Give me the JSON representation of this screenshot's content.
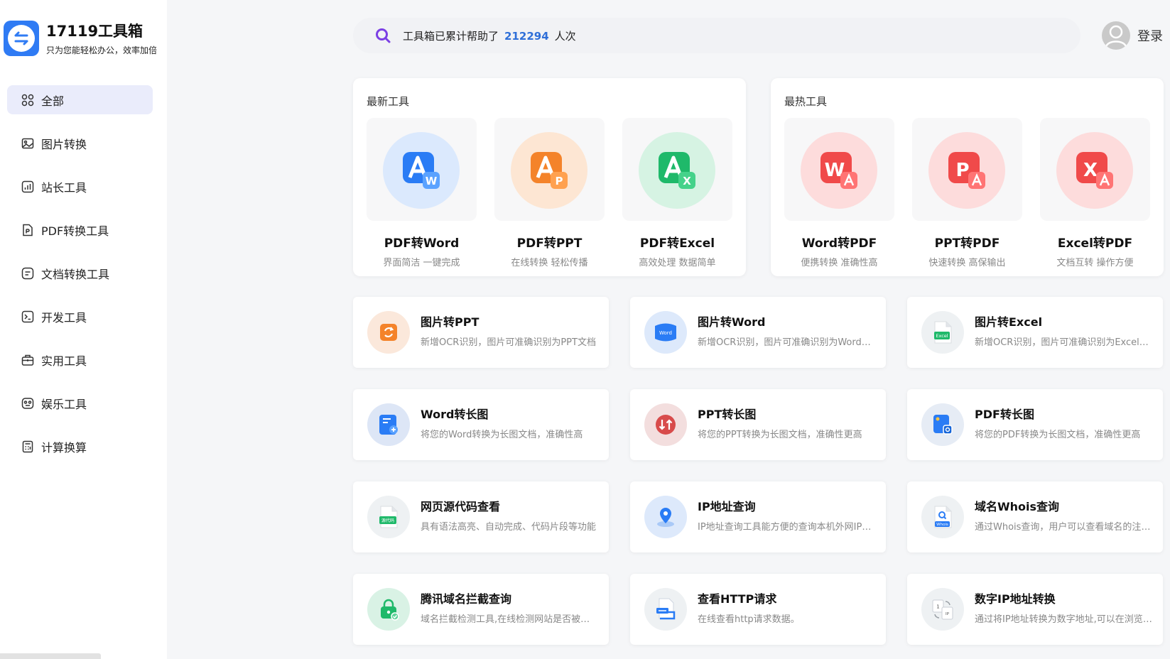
{
  "brand": {
    "name": "17119工具箱",
    "tagline": "只为您能轻松办公，效率加倍"
  },
  "sidebar": {
    "items": [
      {
        "label": "全部",
        "icon": "grid-icon",
        "active": true
      },
      {
        "label": "图片转换",
        "icon": "image-icon"
      },
      {
        "label": "站长工具",
        "icon": "chart-icon"
      },
      {
        "label": "PDF转换工具",
        "icon": "pdf-icon"
      },
      {
        "label": "文档转换工具",
        "icon": "document-icon"
      },
      {
        "label": "开发工具",
        "icon": "terminal-icon"
      },
      {
        "label": "实用工具",
        "icon": "toolbox-icon"
      },
      {
        "label": "娱乐工具",
        "icon": "game-icon"
      },
      {
        "label": "计算换算",
        "icon": "calculator-icon"
      }
    ]
  },
  "search": {
    "prefix": "工具箱已累计帮助了",
    "count": "212294",
    "suffix": "人次"
  },
  "user": {
    "login_label": "登录"
  },
  "featured": {
    "latest": {
      "title": "最新工具",
      "items": [
        {
          "name": "PDF转Word",
          "desc": "界面简洁 一键完成",
          "icon": "pdf-to-word-icon",
          "color": "#2a7cf5"
        },
        {
          "name": "PDF转PPT",
          "desc": "在线转换 轻松传播",
          "icon": "pdf-to-ppt-icon",
          "color": "#f4832a"
        },
        {
          "name": "PDF转Excel",
          "desc": "高效处理 数据简单",
          "icon": "pdf-to-excel-icon",
          "color": "#1fb96a"
        }
      ]
    },
    "hottest": {
      "title": "最热工具",
      "items": [
        {
          "name": "Word转PDF",
          "desc": "便携转换 准确性高",
          "icon": "word-to-pdf-icon",
          "color": "#f04a4a"
        },
        {
          "name": "PPT转PDF",
          "desc": "快速转换 高保输出",
          "icon": "ppt-to-pdf-icon",
          "color": "#f04a4a"
        },
        {
          "name": "Excel转PDF",
          "desc": "文档互转 操作方便",
          "icon": "excel-to-pdf-icon",
          "color": "#f04a4a"
        }
      ]
    }
  },
  "tools": [
    {
      "title": "图片转PPT",
      "desc": "新增OCR识别，图片可准确识别为PPT文档",
      "icon": "image-to-ppt-icon",
      "color": "#f4832a"
    },
    {
      "title": "图片转Word",
      "desc": "新增OCR识别，图片可准确识别为Word文档",
      "icon": "image-to-word-icon",
      "color": "#2a7cf5",
      "badge": "Word"
    },
    {
      "title": "图片转Excel",
      "desc": "新增OCR识别，图片可准确识别为Excel文档",
      "icon": "image-to-excel-icon",
      "color": "#1fb96a",
      "badge": "Excel"
    },
    {
      "title": "Word转长图",
      "desc": "将您的Word转换为长图文档，准确性高",
      "icon": "word-to-long-image-icon",
      "color": "#2a7cf5"
    },
    {
      "title": "PPT转长图",
      "desc": "将您的PPT转换为长图文档，准确性更高",
      "icon": "ppt-to-long-image-icon",
      "color": "#d84b4b"
    },
    {
      "title": "PDF转长图",
      "desc": "将您的PDF转换为长图文档，准确性更高",
      "icon": "pdf-to-long-image-icon",
      "color": "#2a7cf5"
    },
    {
      "title": "网页源代码查看",
      "desc": "具有语法高亮、自动完成、代码片段等功能",
      "icon": "source-code-icon",
      "color": "#1fb96a",
      "badge": "源代码"
    },
    {
      "title": "IP地址查询",
      "desc": "IP地址查询工具能方便的查询本机外网IP地址",
      "icon": "location-pin-icon",
      "color": "#2a7cf5"
    },
    {
      "title": "域名Whois查询",
      "desc": "通过Whois查询，用户可以查看域名的注册信息",
      "icon": "whois-icon",
      "color": "#2a7cf5",
      "badge": "Whois"
    },
    {
      "title": "腾讯域名拦截查询",
      "desc": "域名拦截检测工具,在线检测网站是否被拦截",
      "icon": "lock-icon",
      "color": "#1fb96a"
    },
    {
      "title": "查看HTTP请求",
      "desc": "在线查看http请求数据。",
      "icon": "http-request-icon",
      "color": "#2a7cf5"
    },
    {
      "title": "数字IP地址转换",
      "desc": "通过将IP地址转换为数字地址,可以在浏览器中访问",
      "icon": "ip-convert-icon",
      "color": "#9aa0a6"
    }
  ]
}
